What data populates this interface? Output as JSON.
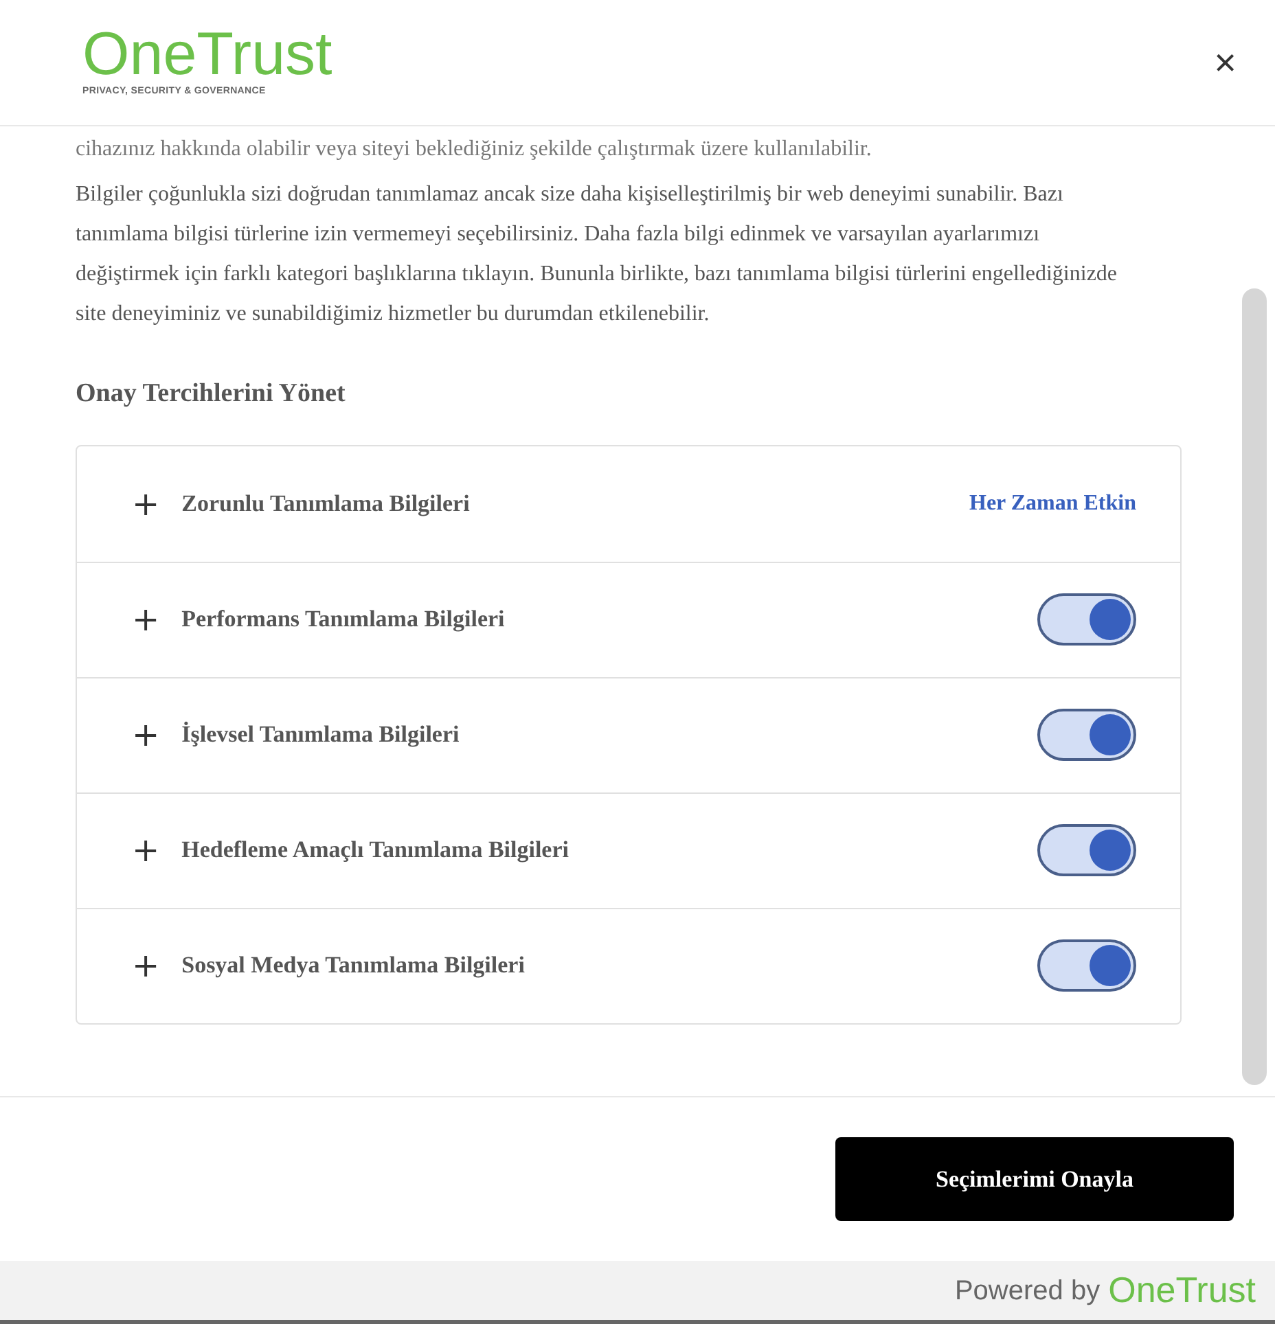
{
  "header": {
    "logo": "OneTrust",
    "tagline": "PRIVACY, SECURITY & GOVERNANCE",
    "close": "×"
  },
  "description": [
    "cihazınız hakkında olabilir veya siteyi beklediğiniz şekilde çalıştırmak üzere kullanılabilir.",
    "Bilgiler çoğunlukla sizi doğrudan tanımlamaz ancak size daha kişiselleştirilmiş bir web deneyimi sunabilir. Bazı tanımlama bilgisi türlerine izin vermemeyi seçebilirsiniz. Daha fazla bilgi edinmek ve varsayılan ayarlarımızı değiştirmek için farklı kategori başlıklarına tıklayın. Bununla birlikte, bazı tanımlama bilgisi türlerini engellediğinizde site deneyiminiz ve sunabildiğimiz hizmetler bu durumdan etkilenebilir."
  ],
  "section_title": "Onay Tercihlerini Yönet",
  "categories": [
    {
      "kind": "always",
      "expand": "+",
      "label": "Zorunlu Tanımlama Bilgileri",
      "status": "Her Zaman Etkin"
    },
    {
      "kind": "toggle",
      "expand": "+",
      "label": "Performans Tanımlama Bilgileri",
      "on": true
    },
    {
      "kind": "toggle",
      "expand": "+",
      "label": "İşlevsel Tanımlama Bilgileri",
      "on": true
    },
    {
      "kind": "toggle",
      "expand": "+",
      "label": "Hedefleme Amaçlı Tanımlama Bilgileri",
      "on": true
    },
    {
      "kind": "toggle",
      "expand": "+",
      "label": "Sosyal Medya Tanımlama Bilgileri",
      "on": true
    }
  ],
  "confirm_button": "Seçimlerimi Onayla",
  "footer": {
    "powered_by": "Powered by",
    "brand": "OneTrust"
  }
}
